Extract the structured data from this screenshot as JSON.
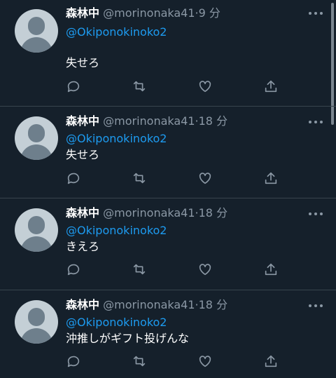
{
  "tweets": [
    {
      "name": "森林中",
      "handle": "@morinonaka41",
      "sep": "·",
      "time": "9 分",
      "mention": "@Okiponokinoko2",
      "text": "失せろ"
    },
    {
      "name": "森林中",
      "handle": "@morinonaka41",
      "sep": "·",
      "time": "18 分",
      "mention": "@Okiponokinoko2",
      "text": "失せろ"
    },
    {
      "name": "森林中",
      "handle": "@morinonaka41",
      "sep": "·",
      "time": "18 分",
      "mention": "@Okiponokinoko2",
      "text": "きえろ"
    },
    {
      "name": "森林中",
      "handle": "@morinonaka41",
      "sep": "·",
      "time": "18 分",
      "mention": "@Okiponokinoko2",
      "text": "沖推しがギフト投げんな"
    }
  ],
  "icons": {
    "reply": "reply-icon",
    "retweet": "retweet-icon",
    "like": "heart-icon",
    "share": "share-icon",
    "more": "more-icon",
    "avatar": "default-avatar-icon"
  },
  "colors": {
    "background": "#15202b",
    "mention": "#1d9bf0",
    "secondary_text": "#8b98a5",
    "divider": "#38444d"
  }
}
